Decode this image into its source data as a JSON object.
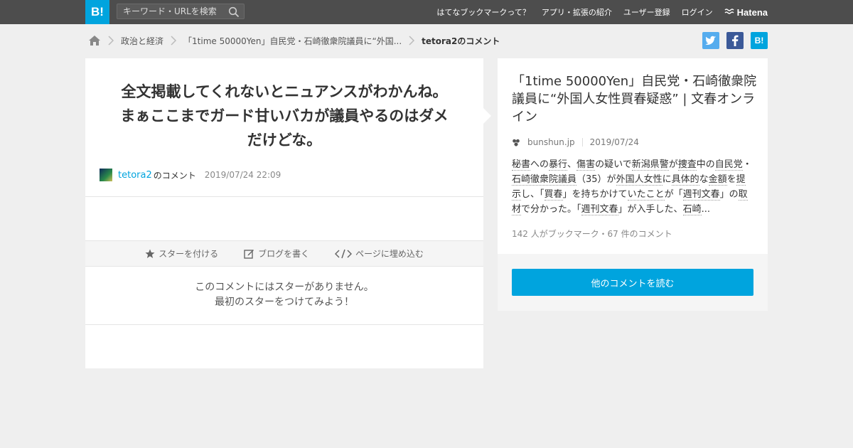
{
  "header": {
    "logo_text": "B!",
    "search_placeholder": "キーワード・URLを検索",
    "nav": [
      "はてなブックマークって？",
      "アプリ・拡張の紹介",
      "ユーザー登録",
      "ログイン"
    ],
    "brand": "Hatena"
  },
  "breadcrumb": {
    "items": [
      "政治と経済",
      "「1time 50000Yen」自民党・石崎徹衆院議員に“外国..."
    ],
    "current": "tetora2のコメント"
  },
  "share": {
    "twitter": "t",
    "facebook": "f",
    "hatena": "B!"
  },
  "comment": {
    "text": "全文掲載してくれないとニュアンスがわかんね。まぁここまでガード甘いバカが議員やるのはダメだけどな。",
    "user": "tetora2",
    "user_suffix": "のコメント",
    "date": "2019/07/24 22:09"
  },
  "actions": {
    "star": "スターを付ける",
    "blog": "ブログを書く",
    "embed": "ページに埋め込む"
  },
  "stars": {
    "empty_line1": "このコメントにはスターがありません。",
    "empty_line2": "最初のスターをつけてみよう！"
  },
  "entry": {
    "title": "「1time 50000Yen」自民党・石崎徹衆院議員に“外国人女性買春疑惑” | 文春オンライン",
    "domain": "bunshun.jp",
    "date": "2019/07/24",
    "summary": [
      {
        "t": "秘書",
        "k": true
      },
      {
        "t": "への",
        "k": false
      },
      {
        "t": "暴行",
        "k": true
      },
      {
        "t": "、",
        "k": false
      },
      {
        "t": "傷害",
        "k": true
      },
      {
        "t": "の疑いで",
        "k": false
      },
      {
        "t": "新潟県警",
        "k": true
      },
      {
        "t": "が",
        "k": false
      },
      {
        "t": "捜査",
        "k": true
      },
      {
        "t": "中の",
        "k": false
      },
      {
        "t": "自民党",
        "k": true
      },
      {
        "t": "・",
        "k": false
      },
      {
        "t": "石崎徹衆院議員",
        "k": true
      },
      {
        "t": "（35）が",
        "k": false
      },
      {
        "t": "外国人女性",
        "k": true
      },
      {
        "t": "に",
        "k": false
      },
      {
        "t": "具体的",
        "k": true
      },
      {
        "t": "な",
        "k": false
      },
      {
        "t": "金額",
        "k": true
      },
      {
        "t": "を",
        "k": false
      },
      {
        "t": "提示",
        "k": true
      },
      {
        "t": "し、「",
        "k": false
      },
      {
        "t": "買春",
        "k": true
      },
      {
        "t": "」を持ちかけて",
        "k": false
      },
      {
        "t": "いたこと",
        "k": true
      },
      {
        "t": "が「",
        "k": false
      },
      {
        "t": "週刊文春",
        "k": true
      },
      {
        "t": "」の",
        "k": false
      },
      {
        "t": "取材",
        "k": true
      },
      {
        "t": "で分かった。「",
        "k": false
      },
      {
        "t": "週刊文春",
        "k": true
      },
      {
        "t": "」が入手した、",
        "k": false
      },
      {
        "t": "石崎",
        "k": true
      },
      {
        "t": "...",
        "k": false
      }
    ],
    "counts": "142 人がブックマーク・67 件のコメント"
  },
  "read_more": "他のコメントを読む",
  "colors": {
    "accent": "#00a4de",
    "twitter": "#55acee",
    "facebook": "#3b5998",
    "topbar": "#4d4d4d"
  }
}
